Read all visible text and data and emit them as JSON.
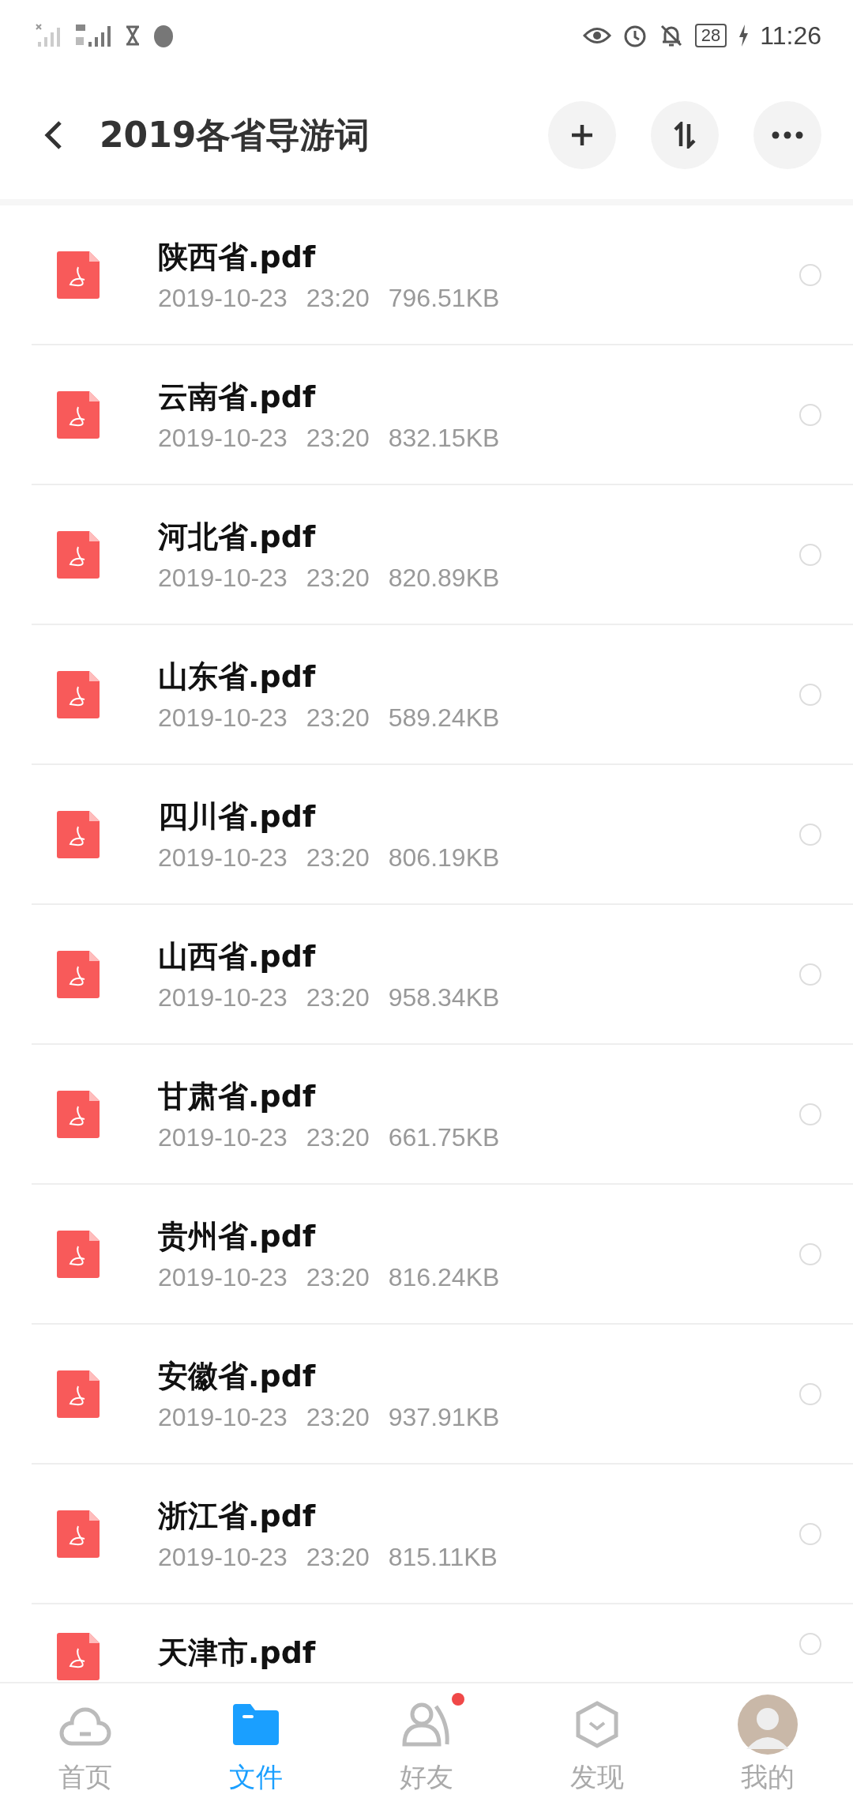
{
  "status_bar": {
    "battery": "28",
    "time": "11:26"
  },
  "header": {
    "title": "2019各省导游词"
  },
  "files": [
    {
      "name": "陕西省.pdf",
      "date": "2019-10-23",
      "time": "23:20",
      "size": "796.51KB",
      "checked": false
    },
    {
      "name": "云南省.pdf",
      "date": "2019-10-23",
      "time": "23:20",
      "size": "832.15KB",
      "checked": false
    },
    {
      "name": "河北省.pdf",
      "date": "2019-10-23",
      "time": "23:20",
      "size": "820.89KB",
      "checked": false
    },
    {
      "name": "山东省.pdf",
      "date": "2019-10-23",
      "time": "23:20",
      "size": "589.24KB",
      "checked": false
    },
    {
      "name": "四川省.pdf",
      "date": "2019-10-23",
      "time": "23:20",
      "size": "806.19KB",
      "checked": false
    },
    {
      "name": "山西省.pdf",
      "date": "2019-10-23",
      "time": "23:20",
      "size": "958.34KB",
      "checked": false
    },
    {
      "name": "甘肃省.pdf",
      "date": "2019-10-23",
      "time": "23:20",
      "size": "661.75KB",
      "checked": false
    },
    {
      "name": "贵州省.pdf",
      "date": "2019-10-23",
      "time": "23:20",
      "size": "816.24KB",
      "checked": false
    },
    {
      "name": "安徽省.pdf",
      "date": "2019-10-23",
      "time": "23:20",
      "size": "937.91KB",
      "checked": false
    },
    {
      "name": "浙江省.pdf",
      "date": "2019-10-23",
      "time": "23:20",
      "size": "815.11KB",
      "checked": false
    },
    {
      "name": "天津市.pdf",
      "checked": false
    }
  ],
  "tabs": [
    {
      "label": "首页",
      "kind": "cloud",
      "selected": false,
      "badge": false
    },
    {
      "label": "文件",
      "kind": "folder",
      "selected": true,
      "badge": false
    },
    {
      "label": "好友",
      "kind": "friends",
      "selected": false,
      "badge": true
    },
    {
      "label": "发现",
      "kind": "discover",
      "selected": false,
      "badge": false
    },
    {
      "label": "我的",
      "kind": "avatar",
      "selected": false,
      "badge": false
    }
  ]
}
